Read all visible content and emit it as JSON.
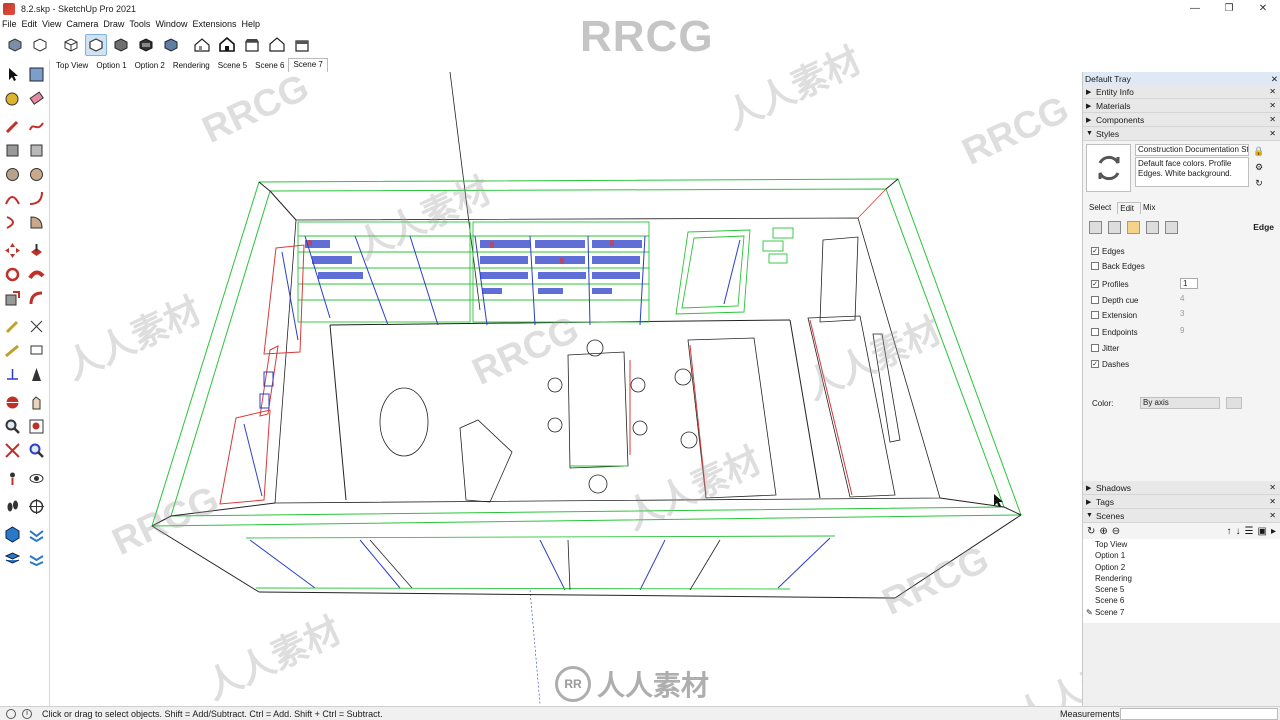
{
  "window": {
    "title": "8.2.skp - SketchUp Pro 2021",
    "minimize": "—",
    "restore": "❐",
    "close": "✕"
  },
  "menu": [
    "File",
    "Edit",
    "View",
    "Camera",
    "Draw",
    "Tools",
    "Window",
    "Extensions",
    "Help"
  ],
  "toolbar_icons": [
    "iso-view-icon",
    "hidden-line-icon",
    "xray-icon",
    "wireframe-icon",
    "shaded-icon",
    "shaded-texture-icon",
    "monochrome-icon",
    "top-view-icon",
    "iso-house-icon",
    "front-house-icon",
    "right-house-icon",
    "back-house-icon",
    "left-house-icon"
  ],
  "scene_tabs": [
    "Top View",
    "Option 1",
    "Option 2",
    "Rendering",
    "Scene 5",
    "Scene 6",
    "Scene 7"
  ],
  "selected_scene_tab": "Scene 7",
  "watermark": {
    "top": "RRCG",
    "bottom": "人人素材",
    "diag_1": "RRCG",
    "diag_2": "人人素材",
    "logo": "RR"
  },
  "tray": {
    "title": "Default Tray",
    "sections_top": [
      "Entity Info",
      "Materials",
      "Components"
    ],
    "styles": {
      "label": "Styles",
      "style_name": "Construction Documentation St",
      "style_desc": "Default face colors. Profile Edges. White background.",
      "tabs": [
        "Select",
        "Edit",
        "Mix"
      ],
      "active_tab": "Edit",
      "panel_label": "Edge",
      "options": [
        {
          "label": "Edges",
          "checked": true
        },
        {
          "label": "Back Edges",
          "checked": false
        },
        {
          "label": "Profiles",
          "checked": true,
          "value": "1"
        },
        {
          "label": "Depth cue",
          "checked": false,
          "value": "4"
        },
        {
          "label": "Extension",
          "checked": false,
          "value": "3"
        },
        {
          "label": "Endpoints",
          "checked": false,
          "value": "9"
        },
        {
          "label": "Jitter",
          "checked": false
        },
        {
          "label": "Dashes",
          "checked": true
        }
      ],
      "color_label": "Color:",
      "color_value": "By axis"
    },
    "sections_bottom": [
      "Shadows",
      "Tags",
      "Scenes"
    ],
    "scenes": {
      "items": [
        "Top View",
        "Option 1",
        "Option 2",
        "Rendering",
        "Scene 5",
        "Scene 6",
        "Scene 7"
      ],
      "current": "Scene 7"
    }
  },
  "status": {
    "message": "Click or drag to select objects. Shift = Add/Subtract. Ctrl = Add. Shift + Ctrl = Subtract.",
    "measurements_label": "Measurements"
  },
  "colors": {
    "edge": "#1a1a1a",
    "axis_red": "#d83a3a",
    "axis_green": "#29c43a",
    "axis_blue": "#2a3fc8",
    "tray_bg": "#f0f0f0"
  }
}
